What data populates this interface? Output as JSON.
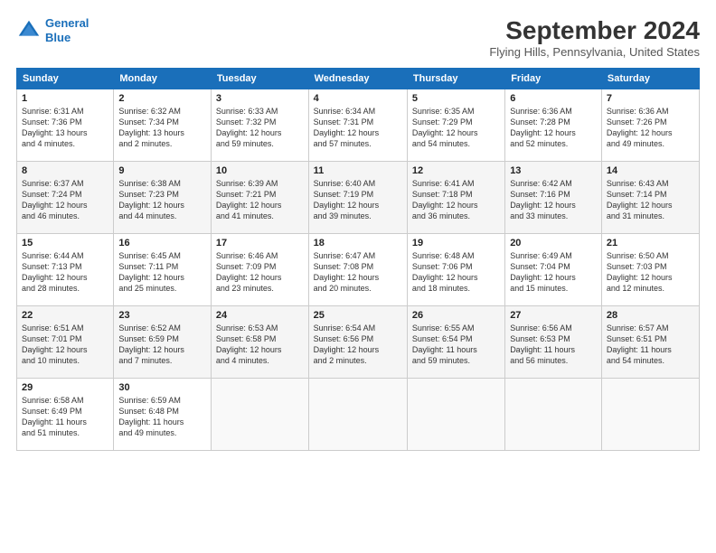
{
  "header": {
    "logo_line1": "General",
    "logo_line2": "Blue",
    "month_year": "September 2024",
    "location": "Flying Hills, Pennsylvania, United States"
  },
  "days_of_week": [
    "Sunday",
    "Monday",
    "Tuesday",
    "Wednesday",
    "Thursday",
    "Friday",
    "Saturday"
  ],
  "weeks": [
    [
      {
        "day": "1",
        "info": "Sunrise: 6:31 AM\nSunset: 7:36 PM\nDaylight: 13 hours\nand 4 minutes."
      },
      {
        "day": "2",
        "info": "Sunrise: 6:32 AM\nSunset: 7:34 PM\nDaylight: 13 hours\nand 2 minutes."
      },
      {
        "day": "3",
        "info": "Sunrise: 6:33 AM\nSunset: 7:32 PM\nDaylight: 12 hours\nand 59 minutes."
      },
      {
        "day": "4",
        "info": "Sunrise: 6:34 AM\nSunset: 7:31 PM\nDaylight: 12 hours\nand 57 minutes."
      },
      {
        "day": "5",
        "info": "Sunrise: 6:35 AM\nSunset: 7:29 PM\nDaylight: 12 hours\nand 54 minutes."
      },
      {
        "day": "6",
        "info": "Sunrise: 6:36 AM\nSunset: 7:28 PM\nDaylight: 12 hours\nand 52 minutes."
      },
      {
        "day": "7",
        "info": "Sunrise: 6:36 AM\nSunset: 7:26 PM\nDaylight: 12 hours\nand 49 minutes."
      }
    ],
    [
      {
        "day": "8",
        "info": "Sunrise: 6:37 AM\nSunset: 7:24 PM\nDaylight: 12 hours\nand 46 minutes."
      },
      {
        "day": "9",
        "info": "Sunrise: 6:38 AM\nSunset: 7:23 PM\nDaylight: 12 hours\nand 44 minutes."
      },
      {
        "day": "10",
        "info": "Sunrise: 6:39 AM\nSunset: 7:21 PM\nDaylight: 12 hours\nand 41 minutes."
      },
      {
        "day": "11",
        "info": "Sunrise: 6:40 AM\nSunset: 7:19 PM\nDaylight: 12 hours\nand 39 minutes."
      },
      {
        "day": "12",
        "info": "Sunrise: 6:41 AM\nSunset: 7:18 PM\nDaylight: 12 hours\nand 36 minutes."
      },
      {
        "day": "13",
        "info": "Sunrise: 6:42 AM\nSunset: 7:16 PM\nDaylight: 12 hours\nand 33 minutes."
      },
      {
        "day": "14",
        "info": "Sunrise: 6:43 AM\nSunset: 7:14 PM\nDaylight: 12 hours\nand 31 minutes."
      }
    ],
    [
      {
        "day": "15",
        "info": "Sunrise: 6:44 AM\nSunset: 7:13 PM\nDaylight: 12 hours\nand 28 minutes."
      },
      {
        "day": "16",
        "info": "Sunrise: 6:45 AM\nSunset: 7:11 PM\nDaylight: 12 hours\nand 25 minutes."
      },
      {
        "day": "17",
        "info": "Sunrise: 6:46 AM\nSunset: 7:09 PM\nDaylight: 12 hours\nand 23 minutes."
      },
      {
        "day": "18",
        "info": "Sunrise: 6:47 AM\nSunset: 7:08 PM\nDaylight: 12 hours\nand 20 minutes."
      },
      {
        "day": "19",
        "info": "Sunrise: 6:48 AM\nSunset: 7:06 PM\nDaylight: 12 hours\nand 18 minutes."
      },
      {
        "day": "20",
        "info": "Sunrise: 6:49 AM\nSunset: 7:04 PM\nDaylight: 12 hours\nand 15 minutes."
      },
      {
        "day": "21",
        "info": "Sunrise: 6:50 AM\nSunset: 7:03 PM\nDaylight: 12 hours\nand 12 minutes."
      }
    ],
    [
      {
        "day": "22",
        "info": "Sunrise: 6:51 AM\nSunset: 7:01 PM\nDaylight: 12 hours\nand 10 minutes."
      },
      {
        "day": "23",
        "info": "Sunrise: 6:52 AM\nSunset: 6:59 PM\nDaylight: 12 hours\nand 7 minutes."
      },
      {
        "day": "24",
        "info": "Sunrise: 6:53 AM\nSunset: 6:58 PM\nDaylight: 12 hours\nand 4 minutes."
      },
      {
        "day": "25",
        "info": "Sunrise: 6:54 AM\nSunset: 6:56 PM\nDaylight: 12 hours\nand 2 minutes."
      },
      {
        "day": "26",
        "info": "Sunrise: 6:55 AM\nSunset: 6:54 PM\nDaylight: 11 hours\nand 59 minutes."
      },
      {
        "day": "27",
        "info": "Sunrise: 6:56 AM\nSunset: 6:53 PM\nDaylight: 11 hours\nand 56 minutes."
      },
      {
        "day": "28",
        "info": "Sunrise: 6:57 AM\nSunset: 6:51 PM\nDaylight: 11 hours\nand 54 minutes."
      }
    ],
    [
      {
        "day": "29",
        "info": "Sunrise: 6:58 AM\nSunset: 6:49 PM\nDaylight: 11 hours\nand 51 minutes."
      },
      {
        "day": "30",
        "info": "Sunrise: 6:59 AM\nSunset: 6:48 PM\nDaylight: 11 hours\nand 49 minutes."
      },
      {
        "day": "",
        "info": ""
      },
      {
        "day": "",
        "info": ""
      },
      {
        "day": "",
        "info": ""
      },
      {
        "day": "",
        "info": ""
      },
      {
        "day": "",
        "info": ""
      }
    ]
  ]
}
